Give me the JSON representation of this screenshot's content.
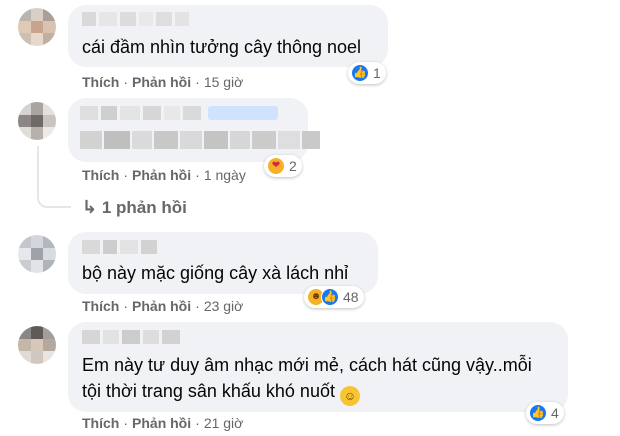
{
  "comments": [
    {
      "text": "cái đầm nhìn tưởng cây thông noel",
      "like_label": "Thích",
      "reply_label": "Phản hồi",
      "time": "15 giờ",
      "reaction_count": "1",
      "reaction_icons": [
        "like-icon"
      ]
    },
    {
      "like_label": "Thích",
      "reply_label": "Phản hồi",
      "time": "1 ngày",
      "reaction_count": "2",
      "reaction_icons": [
        "kiss-icon"
      ],
      "replies_label": "1 phản hồi"
    },
    {
      "text": "bộ này mặc giống cây xà lách nhỉ",
      "like_label": "Thích",
      "reply_label": "Phản hồi",
      "time": "23 giờ",
      "reaction_count": "48",
      "reaction_icons": [
        "haha-icon",
        "like-icon"
      ]
    },
    {
      "text_line1": "Em này tư duy âm nhạc mới mẻ, cách hát cũng vậy..mỗi",
      "text_line2": "tội thời trang sân khấu khó nuốt",
      "like_label": "Thích",
      "reply_label": "Phản hồi",
      "time": "21 giờ",
      "reaction_count": "4",
      "reaction_icons": [
        "like-icon"
      ]
    }
  ],
  "colors": {
    "bubble": "#f0f2f5",
    "meta_text": "#65676b",
    "like_blue": "#1877f2",
    "emoji_yellow": "#f7b125"
  }
}
